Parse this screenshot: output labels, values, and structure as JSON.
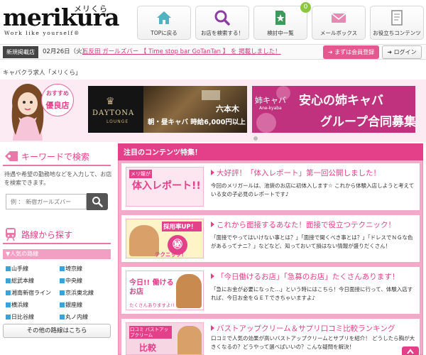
{
  "header": {
    "logo": "merikura",
    "logo_kana": "メリくら",
    "tagline": "Work like yourself®",
    "nav": [
      {
        "label": "TOPに戻る",
        "icon": "home-icon"
      },
      {
        "label": "お店を検索する！",
        "icon": "search-icon"
      },
      {
        "label": "検討中一覧",
        "icon": "star-doc-icon",
        "badge": "0"
      },
      {
        "label": "メールボックス",
        "icon": "mail-icon"
      },
      {
        "label": "お役立ちコンテンツ",
        "icon": "document-icon"
      }
    ]
  },
  "news": {
    "label": "新規掲載店",
    "date": "02月26日（火）",
    "text": "五反田 ガールズバー 【 Time stop bar GoTanTan 】 を 掲載しました！"
  },
  "account": {
    "register": "まずは会員登録",
    "login": "ログイン"
  },
  "breadcrumb": "キャバクラ求人「メリくら」",
  "recommend": {
    "line1": "おすすめ",
    "line2": "優良店"
  },
  "banners": [
    {
      "brand": "DAYTONA",
      "sub": "LOUNGE",
      "area": "六本木",
      "copy": "朝・昼キャバ 時給6,000円以上"
    },
    {
      "brand": "姉キャバ",
      "brand_sub": "Ane-kyaba",
      "line1": "安心の姉キャバ",
      "line2": "グループ合同募集"
    }
  ],
  "keyword_search": {
    "title": "キーワードで検索",
    "description": "待遇や希望の勤務地などを入力して、お店を検索できます。",
    "placeholder": "例 ： 新宿ガールズバー"
  },
  "line_search": {
    "title": "路線から探す",
    "popular_label": "▼人気の路線",
    "lines": [
      "山手線",
      "総武本線",
      "湘南新宿ライン",
      "横浜線",
      "日比谷線",
      "埼京線",
      "中央線",
      "京浜東北線",
      "銀座線",
      "丸ノ内線"
    ],
    "other_button": "その他の路線はこちら"
  },
  "featured": {
    "title": "注目のコンテンツ特集！",
    "items": [
      {
        "title": "大好評！「体入レポート」第一回公開しました！",
        "body": "今回のメリガールは、池袋のお店に初体入します☆ これから体験入店しようと考えている女の子必見のレポートです♪",
        "thumb_text": "体入レポート!!",
        "thumb_small": "メリ嬢が"
      },
      {
        "title": "これから面接するあなた！面接で役立つテクニック！",
        "body": "「面接でやってはいけない事とは？」「面接で聞くべき事とは？」「ドレスでＮＧな色があるってナニ？」などなど、知っておいて損はない情報が盛りだくさん！",
        "thumb_text": "採用率UP！",
        "thumb_small": "テクニック!"
      },
      {
        "title": "「今日働けるお店」「急募のお店」たくさんあります！",
        "body": "「急にお金が必要になった…」という時にはこちら！今日面接に行って、体験入店すれば、今日お金をＧＥＴできちゃいますよ♪",
        "thumb_text": "今日!! 働けるお店",
        "thumb_small": "たくさんありますよ!!"
      },
      {
        "title": "バストアップクリーム＆サプリ口コミ比較ランキング",
        "body": "口コミで人気の効果が高いバストアップクリームとサプリを紹介！ どうしたら胸が大きくなるの？どうやって選べばいいの？こんな疑問を解決！",
        "thumb_text": "比較",
        "thumb_small": "口コミ バストアップクリーム"
      }
    ]
  },
  "colors": {
    "accent": "#e4408a",
    "pink_light": "#f4a9c8",
    "badge": "#8cc63f"
  }
}
